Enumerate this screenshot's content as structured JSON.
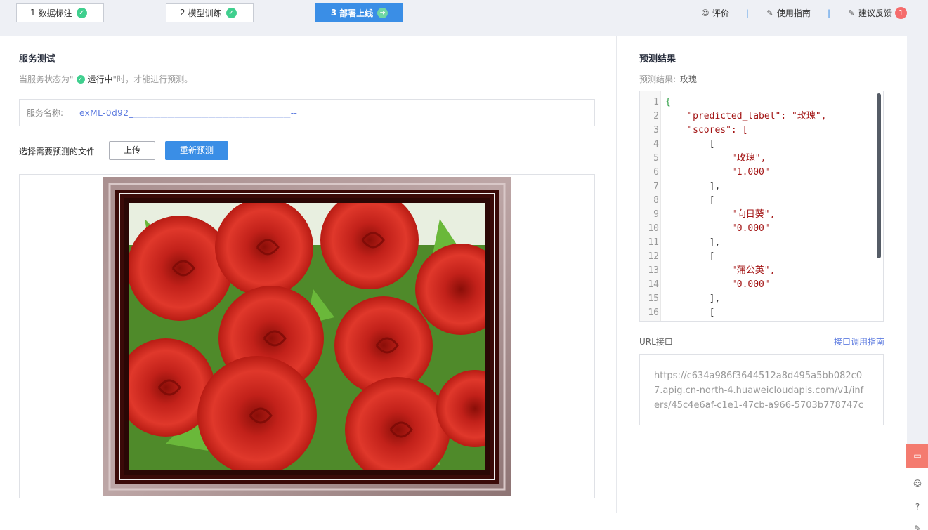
{
  "steps": [
    {
      "num": "1",
      "label": "数据标注",
      "status": "done"
    },
    {
      "num": "2",
      "label": "模型训练",
      "status": "done"
    },
    {
      "num": "3",
      "label": "部署上线",
      "status": "current"
    }
  ],
  "top_links": {
    "rate": "评价",
    "guide": "使用指南",
    "feedback": "建议反馈",
    "feedback_count": "1"
  },
  "service_test": {
    "title": "服务测试",
    "hint_before": "当服务状态为\"",
    "hint_status": "运行中",
    "hint_after": "\"时，才能进行预测。",
    "service_name_label": "服务名称:",
    "service_name_value": "exML-0d92_",
    "service_name_masked": "--",
    "file_label": "选择需要预测的文件",
    "upload_button": "上传",
    "repredict_button": "重新预测"
  },
  "prediction": {
    "title": "预测结果",
    "result_label": "预测结果:",
    "result_value": "玫瑰",
    "code_lines": [
      {
        "n": "1",
        "text": "{"
      },
      {
        "n": "2",
        "text": "    \"predicted_label\": \"玫瑰\","
      },
      {
        "n": "3",
        "text": "    \"scores\": ["
      },
      {
        "n": "4",
        "text": "        ["
      },
      {
        "n": "5",
        "text": "            \"玫瑰\","
      },
      {
        "n": "6",
        "text": "            \"1.000\""
      },
      {
        "n": "7",
        "text": "        ],"
      },
      {
        "n": "8",
        "text": "        ["
      },
      {
        "n": "9",
        "text": "            \"向日葵\","
      },
      {
        "n": "10",
        "text": "            \"0.000\""
      },
      {
        "n": "11",
        "text": "        ],"
      },
      {
        "n": "12",
        "text": "        ["
      },
      {
        "n": "13",
        "text": "            \"蒲公英\","
      },
      {
        "n": "14",
        "text": "            \"0.000\""
      },
      {
        "n": "15",
        "text": "        ],"
      },
      {
        "n": "16",
        "text": "        ["
      }
    ]
  },
  "url_section": {
    "label": "URL接口",
    "guide_link": "接口调用指南",
    "url": "https://c634a986f3644512a8d495a5bb082c07.apig.cn-north-4.huaweicloudapis.com/v1/infers/45c4e6af-c1e1-47cb-a966-5703b778747c"
  },
  "colors": {
    "primary": "#3a8ee6",
    "success": "#3fcf8e",
    "danger": "#f56c6c",
    "rose": "#d42a1e"
  }
}
